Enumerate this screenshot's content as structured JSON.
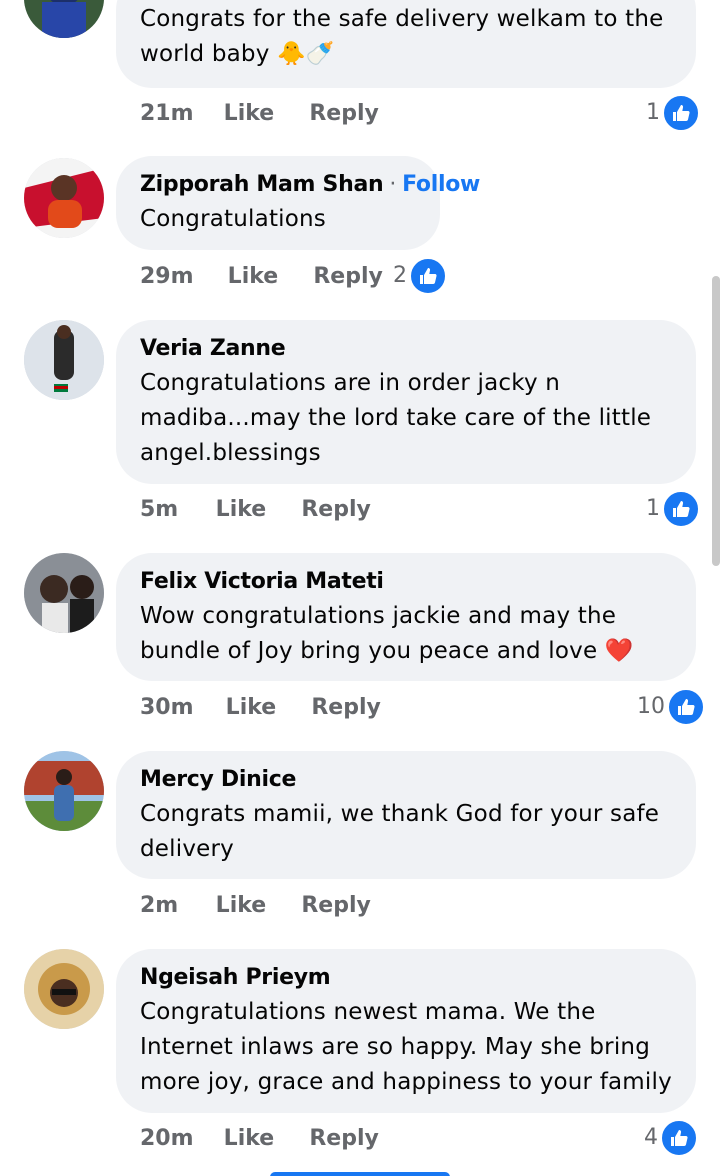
{
  "comments": [
    {
      "author": "",
      "lines": [
        "Congrats for the safe delivery welkam to the",
        "world baby 🐥🍼"
      ],
      "time": "21m",
      "like_label": "Like",
      "reply_label": "Reply",
      "reactions": "1"
    },
    {
      "author": "Zipporah Mam Shan",
      "follow_label": "Follow",
      "lines": [
        "Congratulations"
      ],
      "time": "29m",
      "like_label": "Like",
      "reply_label": "Reply",
      "reactions": "2"
    },
    {
      "author": "Veria Zanne",
      "lines": [
        "Congratulations are in order jacky n",
        "madiba...may the lord take care of the little",
        "angel.blessings"
      ],
      "time": "5m",
      "like_label": "Like",
      "reply_label": "Reply",
      "reactions": "1"
    },
    {
      "author": "Felix Victoria Mateti",
      "lines": [
        "Wow congratulations jackie and may the",
        "bundle of Joy bring you peace and love ❤️"
      ],
      "time": "30m",
      "like_label": "Like",
      "reply_label": "Reply",
      "reactions": "10"
    },
    {
      "author": "Mercy Dinice",
      "lines": [
        "Congrats mamii, we thank God for your safe",
        "delivery"
      ],
      "time": "2m",
      "like_label": "Like",
      "reply_label": "Reply",
      "reactions": ""
    },
    {
      "author": "Ngeisah Prieym",
      "lines": [
        "Congratulations newest mama. We the",
        "Internet inlaws are so happy. May she bring",
        "more joy, grace and happiness to your family"
      ],
      "time": "20m",
      "like_label": "Like",
      "reply_label": "Reply",
      "reactions": "4"
    }
  ],
  "colors": {
    "bubble": "#f0f2f5",
    "accent": "#1877f2",
    "meta_text": "#65676b"
  },
  "icons": {
    "reaction": "thumbs-up-icon"
  }
}
